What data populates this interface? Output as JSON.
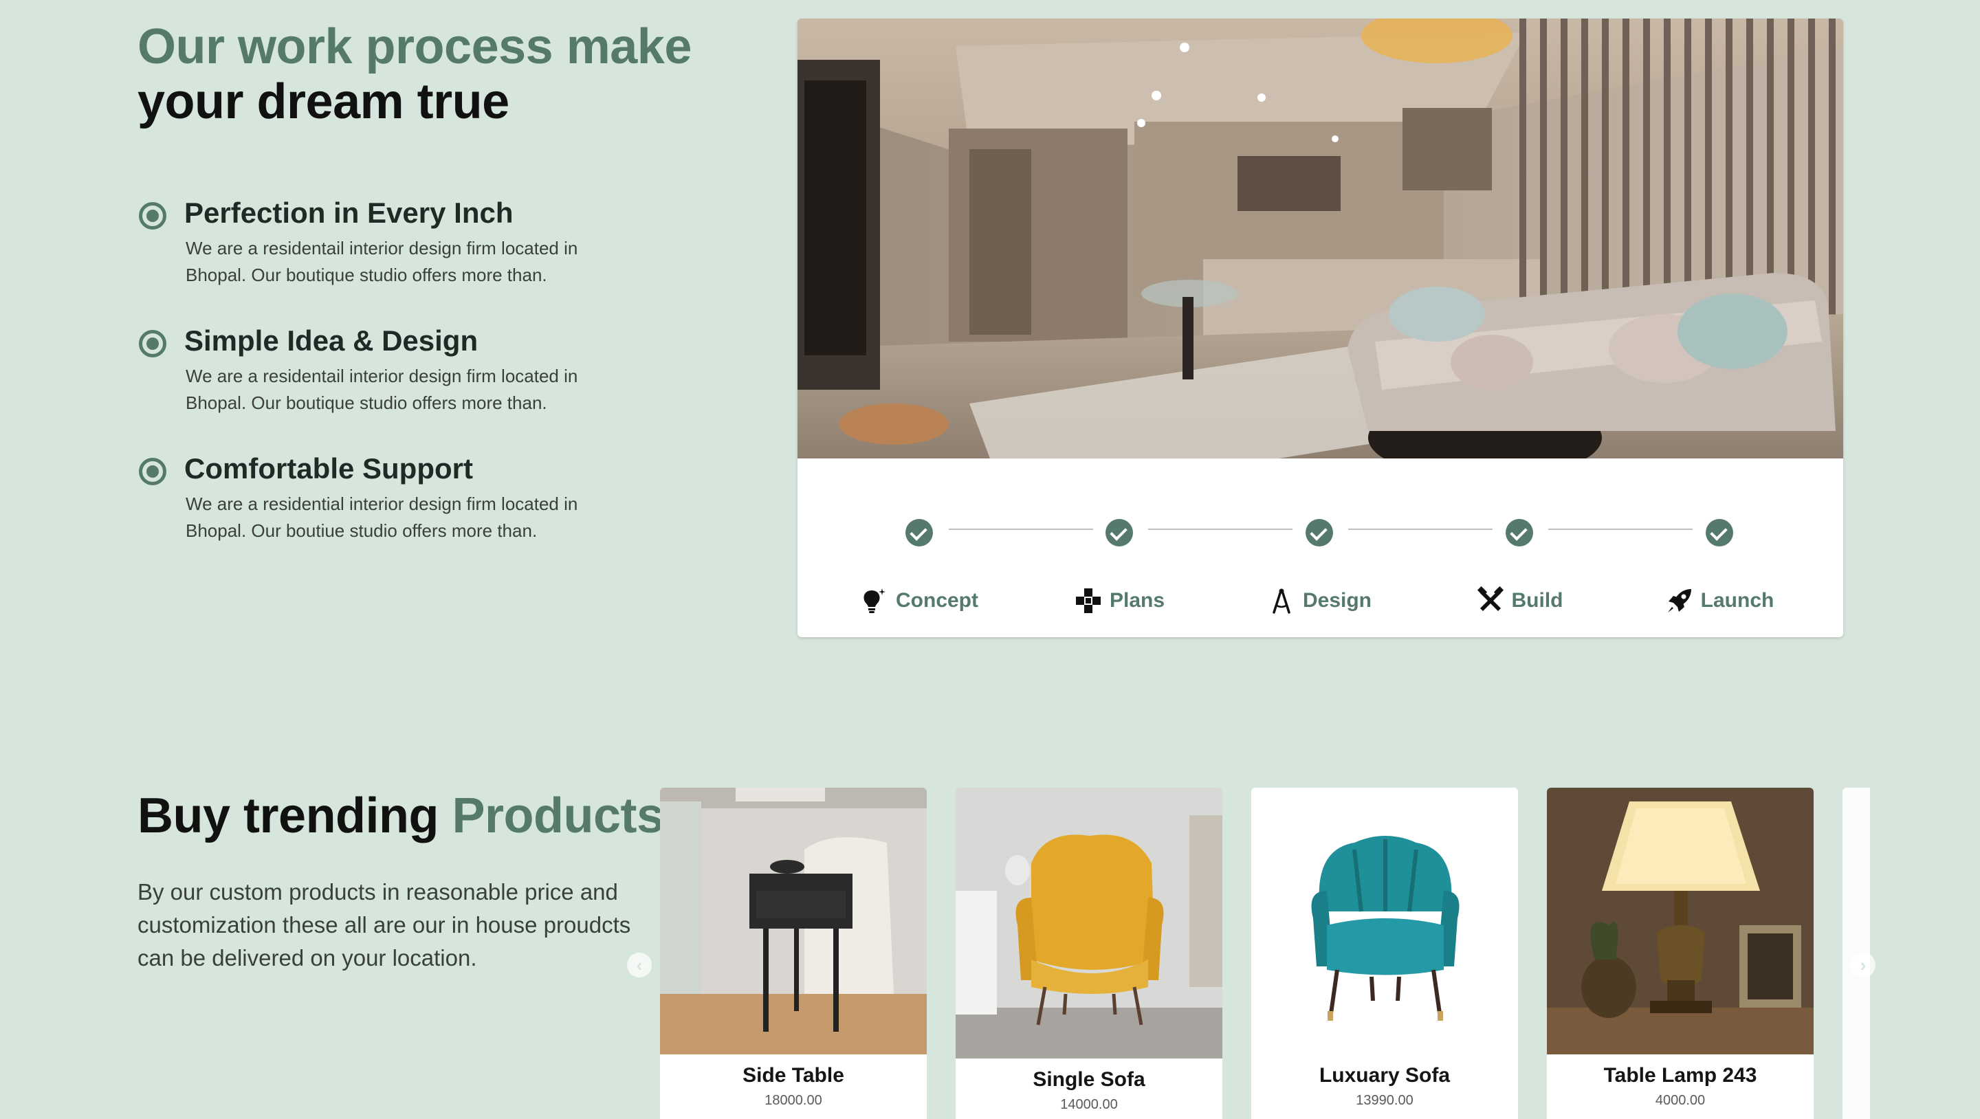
{
  "process": {
    "title_line1": "Our work process make",
    "title_line2": "your dream true",
    "features": [
      {
        "title": "Perfection in Every Inch",
        "text": "We are a residentail interior design firm located in Bhopal. Our boutique studio offers more than."
      },
      {
        "title": "Simple Idea & Design",
        "text": "We are a residentail interior design firm located in Bhopal. Our boutique studio offers more than."
      },
      {
        "title": "Comfortable Support",
        "text": "We are a residential interior design firm located in Bhopal. Our boutiue studio offers more than."
      }
    ],
    "steps": [
      {
        "label": "Concept",
        "icon": "lightbulb-icon"
      },
      {
        "label": "Plans",
        "icon": "puzzle-icon"
      },
      {
        "label": "Design",
        "icon": "compass-icon"
      },
      {
        "label": "Build",
        "icon": "tools-icon"
      },
      {
        "label": "Launch",
        "icon": "rocket-icon"
      }
    ]
  },
  "products": {
    "title_dark": "Buy trending",
    "title_accent": "Products",
    "description": "By our custom products in reasonable price and customization these all are our in house proudcts can be delivered on your location.",
    "items": [
      {
        "name": "Side Table",
        "price": "18000.00"
      },
      {
        "name": "Single Sofa",
        "price": "14000.00"
      },
      {
        "name": "Luxuary Sofa",
        "price": "13990.00"
      },
      {
        "name": "Table Lamp 243",
        "price": "4000.00"
      }
    ]
  },
  "colors": {
    "background": "#d6e6dc",
    "accent": "#557a6c",
    "text_dark": "#111111"
  }
}
